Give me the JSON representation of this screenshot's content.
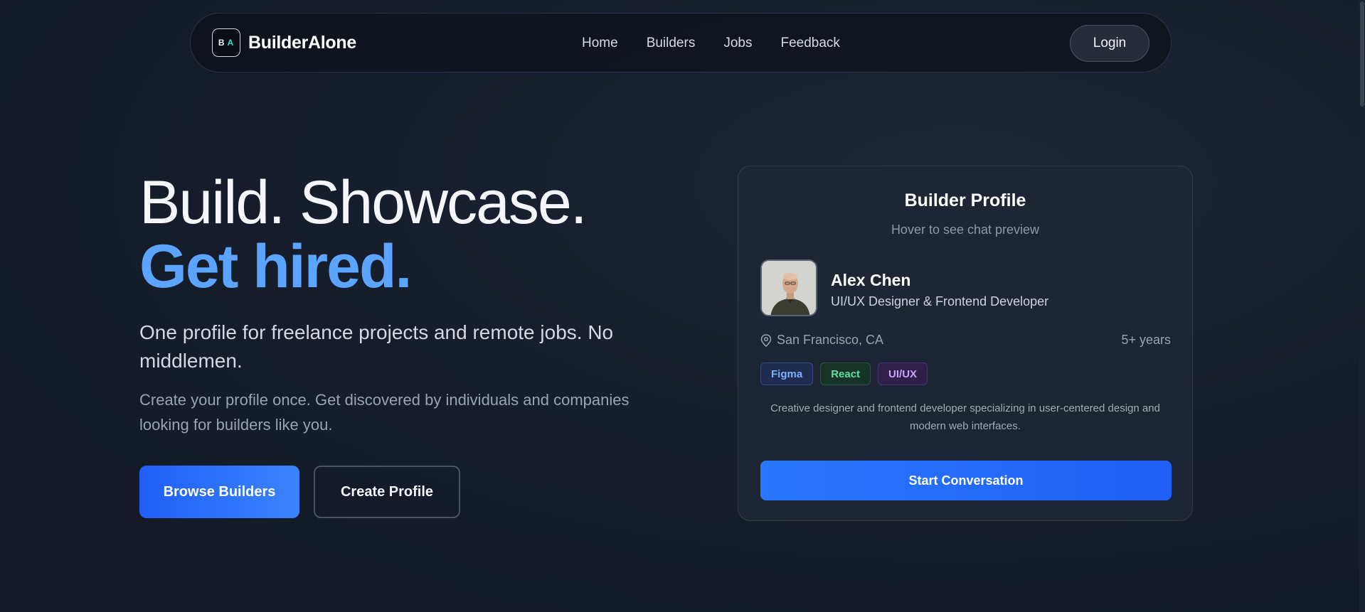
{
  "brand": {
    "logo_letters": "B A",
    "letter_b": "B",
    "letter_a": "A",
    "name": "BuilderAlone"
  },
  "nav": {
    "links": [
      {
        "label": "Home"
      },
      {
        "label": "Builders"
      },
      {
        "label": "Jobs"
      },
      {
        "label": "Feedback"
      }
    ],
    "login_label": "Login"
  },
  "hero": {
    "title_line1": "Build. Showcase.",
    "title_line2": "Get hired.",
    "subtitle": "One profile for freelance projects and remote jobs. No middlemen.",
    "description": "Create your profile once. Get discovered by individuals and companies looking for builders like you.",
    "primary_button": "Browse Builders",
    "secondary_button": "Create Profile"
  },
  "profile_card": {
    "title": "Builder Profile",
    "subtitle": "Hover to see chat preview",
    "name": "Alex Chen",
    "role": "UI/UX Designer & Frontend Developer",
    "location": "San Francisco, CA",
    "experience": "5+ years",
    "tags": [
      "Figma",
      "React",
      "UI/UX"
    ],
    "bio": "Creative designer and frontend developer specializing in user-centered design and modern web interfaces.",
    "cta": "Start Conversation"
  },
  "colors": {
    "accent": "#5ba4ff",
    "primary_button": "#1f5ff6",
    "background": "#161d2b",
    "logo_a": "#3ee0c2"
  },
  "icons": [
    "location-pin-icon"
  ]
}
